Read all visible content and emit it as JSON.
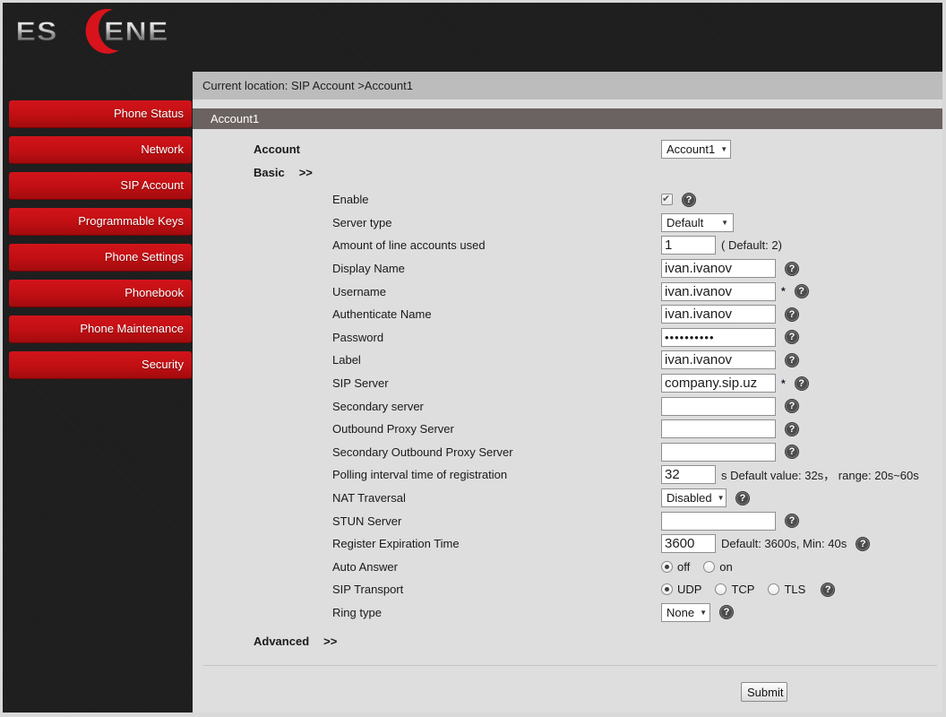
{
  "colors": {
    "accent_red": "#c00f13",
    "titlebar_bg": "#6b6361",
    "breadcrumb_bg": "#bcbcbc",
    "content_bg": "#dedede",
    "dark_bg": "#1e1e1e"
  },
  "logo": {
    "name": "ESCENE",
    "text_left": "ES",
    "text_right": "ENE"
  },
  "sidebar": {
    "items": [
      {
        "label": "Phone Status"
      },
      {
        "label": "Network"
      },
      {
        "label": "SIP Account"
      },
      {
        "label": "Programmable Keys"
      },
      {
        "label": "Phone Settings"
      },
      {
        "label": "Phonebook"
      },
      {
        "label": "Phone Maintenance"
      },
      {
        "label": "Security"
      }
    ]
  },
  "breadcrumb": {
    "text": "Current location: SIP Account >Account1"
  },
  "section": {
    "title": "Account1"
  },
  "form": {
    "account": {
      "label": "Account",
      "value": "Account1"
    },
    "basic_toggle": {
      "label": "Basic",
      "arrows": ">>"
    },
    "advanced_toggle": {
      "label": "Advanced",
      "arrows": ">>"
    },
    "fields": {
      "enable": {
        "label": "Enable",
        "checked": true
      },
      "server_type": {
        "label": "Server type",
        "value": "Default"
      },
      "line_accounts": {
        "label": "Amount of line accounts used",
        "value": "1",
        "note": "( Default: 2)"
      },
      "display_name": {
        "label": "Display Name",
        "value": "ivan.ivanov"
      },
      "username": {
        "label": "Username",
        "value": "ivan.ivanov",
        "required": "*"
      },
      "auth_name": {
        "label": "Authenticate Name",
        "value": "ivan.ivanov"
      },
      "password": {
        "label": "Password",
        "value": "••••••••••"
      },
      "label": {
        "label": "Label",
        "value": "ivan.ivanov"
      },
      "sip_server": {
        "label": "SIP Server",
        "value": "company.sip.uz",
        "required": "*"
      },
      "secondary_server": {
        "label": "Secondary server",
        "value": ""
      },
      "outbound_proxy": {
        "label": "Outbound Proxy Server",
        "value": ""
      },
      "secondary_outbound_proxy": {
        "label": "Secondary Outbound Proxy Server",
        "value": ""
      },
      "polling_interval": {
        "label": "Polling interval time of registration",
        "value": "32",
        "note": "s Default value: 32s， range: 20s~60s"
      },
      "nat_traversal": {
        "label": "NAT Traversal",
        "value": "Disabled"
      },
      "stun_server": {
        "label": "STUN Server",
        "value": ""
      },
      "register_expiration": {
        "label": "Register Expiration Time",
        "value": "3600",
        "note": "Default: 3600s, Min: 40s"
      },
      "auto_answer": {
        "label": "Auto Answer",
        "options": [
          "off",
          "on"
        ],
        "selected": "off"
      },
      "sip_transport": {
        "label": "SIP Transport",
        "options": [
          "UDP",
          "TCP",
          "TLS"
        ],
        "selected": "UDP"
      },
      "ring_type": {
        "label": "Ring type",
        "value": "None"
      }
    },
    "submit": {
      "label": "Submit"
    }
  }
}
